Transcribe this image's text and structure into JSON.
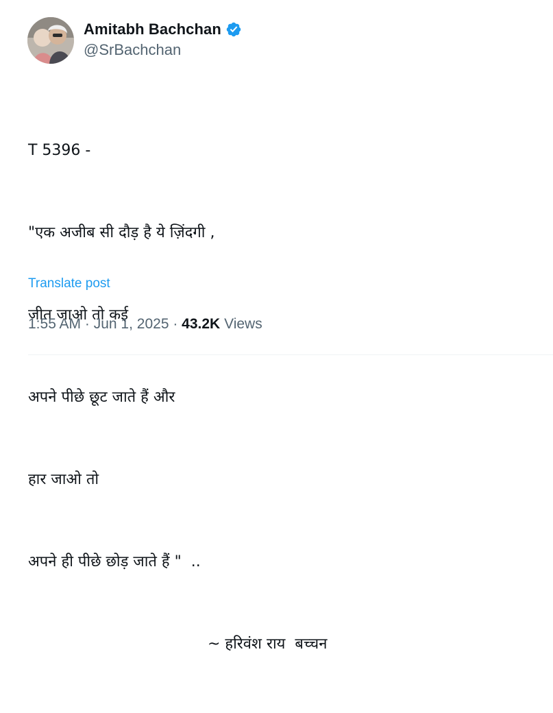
{
  "author": {
    "display_name": "Amitabh Bachchan",
    "handle": "@SrBachchan",
    "verified": true,
    "verified_color": "#1d9bf0"
  },
  "tweet": {
    "lines": [
      "T 5396 -",
      "\"एक अजीब सी दौड़ है ये ज़िंदगी ,",
      "जीत जाओ तो कई",
      "अपने पीछे छूट जाते हैं और",
      "हार जाओ तो",
      "अपने ही पीछे छोड़ जाते हैं \"  ..",
      "~ हरिवंश राय  बच्चन"
    ],
    "translate_label": "Translate post"
  },
  "meta": {
    "time": "1:55 AM",
    "separator": " · ",
    "date": "Jun 1, 2025",
    "views_count": "43.2K",
    "views_label": "Views"
  },
  "colors": {
    "link": "#1d9bf0",
    "secondary_text": "#536471",
    "primary_text": "#0f1419"
  },
  "icons": {
    "avatar": "profile-photo",
    "verified": "verified-badge-icon"
  }
}
